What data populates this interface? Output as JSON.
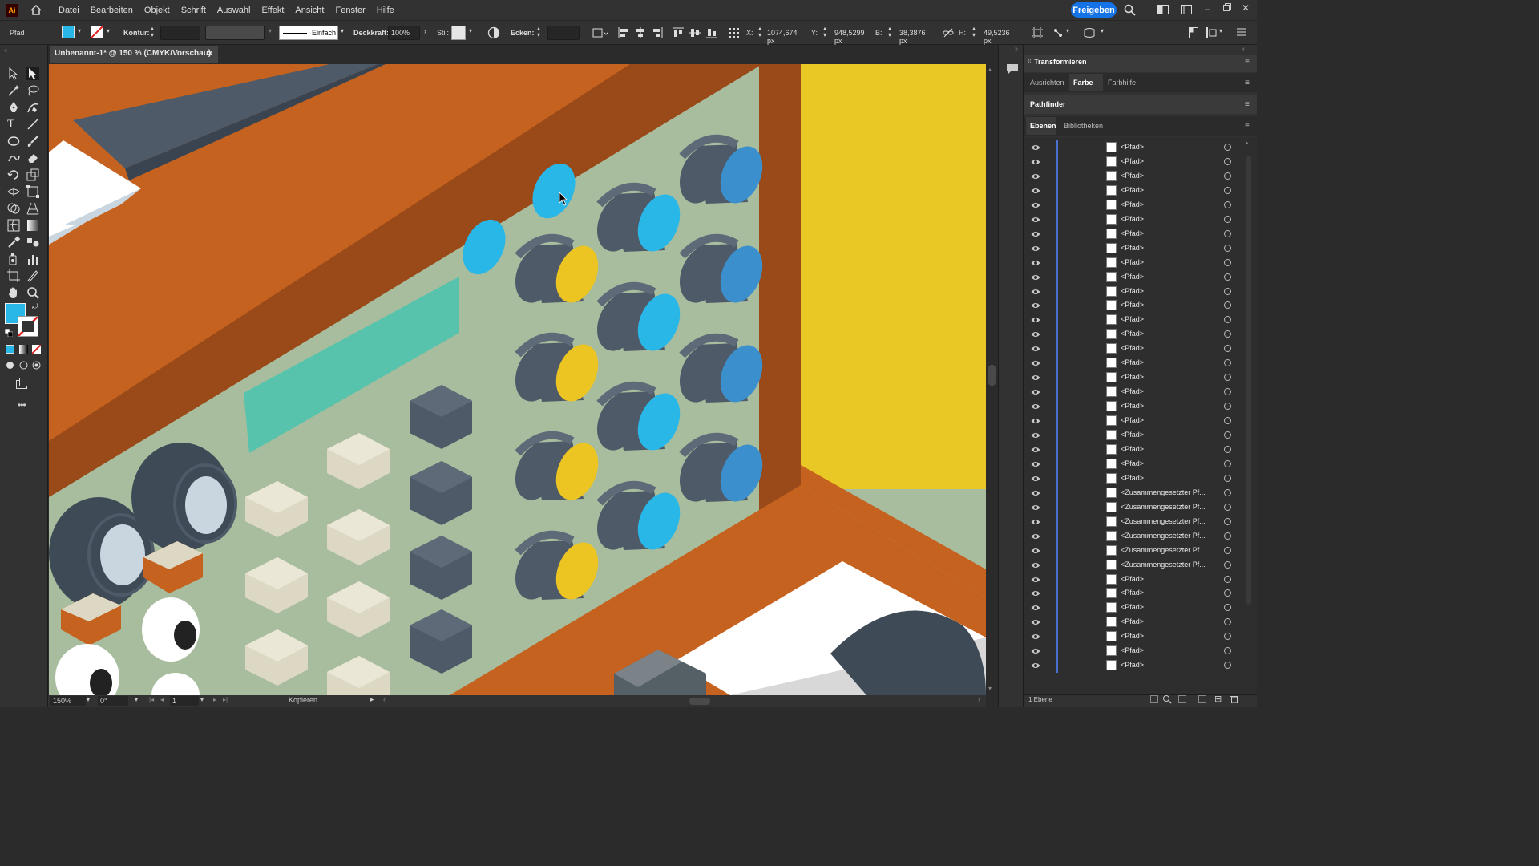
{
  "app": {
    "logo": "Ai",
    "title": "Adobe Illustrator"
  },
  "menu": [
    "Datei",
    "Bearbeiten",
    "Objekt",
    "Schrift",
    "Auswahl",
    "Effekt",
    "Ansicht",
    "Fenster",
    "Hilfe"
  ],
  "share_button": "Freigeben",
  "controlbar": {
    "object_type": "Pfad",
    "stroke_label": "Kontur:",
    "stroke_style": "Einfach",
    "opacity_label": "Deckkraft:",
    "opacity_value": "100%",
    "style_label": "Stil:",
    "corners_label": "Ecken:",
    "x_label": "X:",
    "x_value": "1074,674 px",
    "y_label": "Y:",
    "y_value": "948,5299 px",
    "w_label": "B:",
    "w_value": "38,3876 px",
    "h_label": "H:",
    "h_value": "49,5236 px",
    "fill_color": "#29b7e8"
  },
  "document_tab": {
    "title": "Unbenannt-1* @ 150 % (CMYK/Vorschau)",
    "close": "×"
  },
  "statusbar": {
    "zoom": "150%",
    "rotation": "0°",
    "artboard": "1",
    "status": "Kopieren"
  },
  "panels": {
    "transform": "Transformieren",
    "tabs": [
      {
        "label": "Ausrichten",
        "active": false
      },
      {
        "label": "Farbe",
        "active": true
      },
      {
        "label": "Farbhilfe",
        "active": false
      }
    ],
    "pathfinder": "Pathfinder",
    "layer_tabs": [
      {
        "label": "Ebenen",
        "active": true
      },
      {
        "label": "Bibliotheken",
        "active": false
      }
    ],
    "footer": "1 Ebene"
  },
  "layers": [
    {
      "name": "<Pfad>"
    },
    {
      "name": "<Pfad>"
    },
    {
      "name": "<Pfad>"
    },
    {
      "name": "<Pfad>"
    },
    {
      "name": "<Pfad>"
    },
    {
      "name": "<Pfad>"
    },
    {
      "name": "<Pfad>"
    },
    {
      "name": "<Pfad>"
    },
    {
      "name": "<Pfad>"
    },
    {
      "name": "<Pfad>"
    },
    {
      "name": "<Pfad>"
    },
    {
      "name": "<Pfad>"
    },
    {
      "name": "<Pfad>"
    },
    {
      "name": "<Pfad>"
    },
    {
      "name": "<Pfad>"
    },
    {
      "name": "<Pfad>"
    },
    {
      "name": "<Pfad>"
    },
    {
      "name": "<Pfad>"
    },
    {
      "name": "<Pfad>"
    },
    {
      "name": "<Pfad>"
    },
    {
      "name": "<Pfad>"
    },
    {
      "name": "<Pfad>"
    },
    {
      "name": "<Pfad>"
    },
    {
      "name": "<Pfad>"
    },
    {
      "name": "<Zusammengesetzter Pf..."
    },
    {
      "name": "<Zusammengesetzter Pf..."
    },
    {
      "name": "<Zusammengesetzter Pf..."
    },
    {
      "name": "<Zusammengesetzter Pf..."
    },
    {
      "name": "<Zusammengesetzter Pf..."
    },
    {
      "name": "<Zusammengesetzter Pf..."
    },
    {
      "name": "<Pfad>"
    },
    {
      "name": "<Pfad>"
    },
    {
      "name": "<Pfad>"
    },
    {
      "name": "<Pfad>"
    },
    {
      "name": "<Pfad>"
    },
    {
      "name": "<Pfad>"
    },
    {
      "name": "<Pfad>"
    }
  ],
  "colors": {
    "orange": "#c5621f",
    "dark_orange": "#9a4a18",
    "sage": "#a7bd9e",
    "yellow": "#e9c724",
    "slate": "#4e5a68",
    "cyan": "#29b7e8",
    "blue": "#3a8fcc",
    "teal": "#57c3ad",
    "cream": "#ddd8c3",
    "knob_yellow": "#ecc523"
  }
}
